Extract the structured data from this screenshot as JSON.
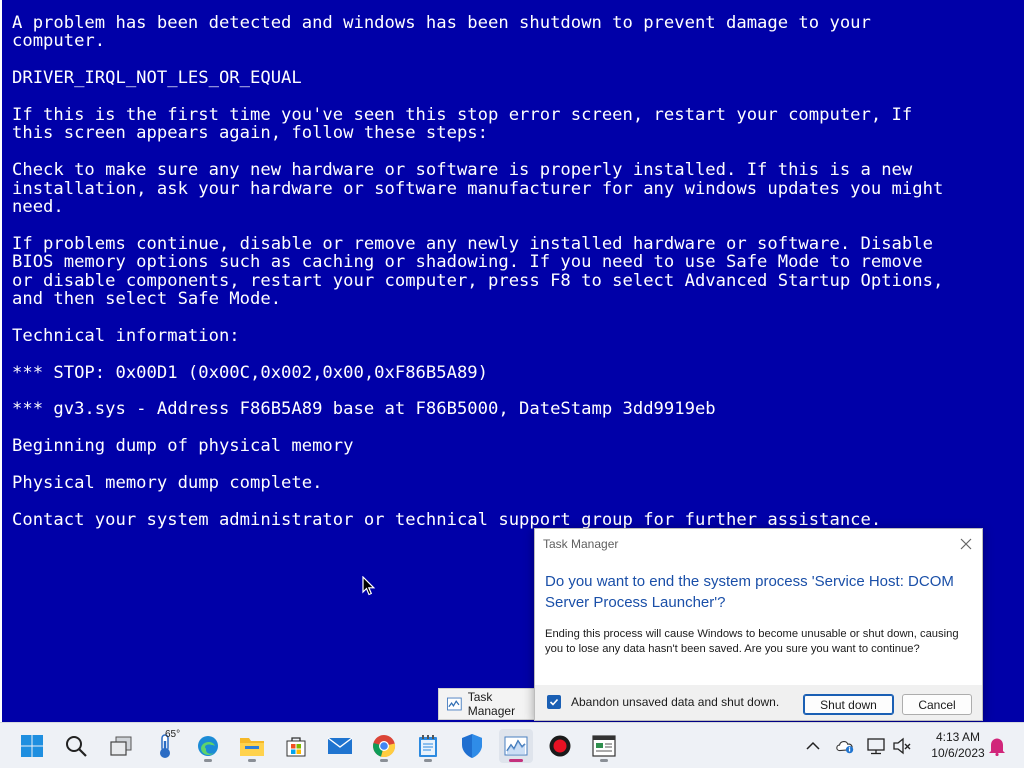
{
  "bsod": {
    "lines": [
      "A problem has been detected and windows has been shutdown to prevent damage to your",
      "computer.",
      "",
      "DRIVER_IRQL_NOT_LES_OR_EQUAL",
      "",
      "If this is the first time you've seen this stop error screen, restart your computer, If",
      "this screen appears again, follow these steps:",
      "",
      "Check to make sure any new hardware or software is properly installed. If this is a new",
      "installation, ask your hardware or software manufacturer for any windows updates you might",
      "need.",
      "",
      "If problems continue, disable or remove any newly installed hardware or software. Disable",
      "BIOS memory options such as caching or shadowing. If you need to use Safe Mode to remove",
      "or disable components, restart your computer, press F8 to select Advanced Startup Options,",
      "and then select Safe Mode.",
      "",
      "Technical information:",
      "",
      "*** STOP: 0x00D1 (0x00C,0x002,0x00,0xF86B5A89)",
      "",
      "*** gv3.sys - Address F86B5A89 base at F86B5000, DateStamp 3dd9919eb",
      "",
      "Beginning dump of physical memory",
      "",
      "Physical memory dump complete.",
      "",
      "Contact your system administrator or technical support group for further assistance."
    ]
  },
  "dialog": {
    "title": "Task Manager",
    "question": "Do you want to end the system process 'Service Host: DCOM Server Process Launcher'?",
    "message": "Ending this process will cause Windows to become unusable or shut down, causing you to lose any data hasn't been saved. Are you sure you want to continue?",
    "checkbox_label": "Abandon unsaved data and shut down.",
    "checkbox_checked": true,
    "shutdown_label": "Shut down",
    "cancel_label": "Cancel"
  },
  "taskbar": {
    "preview_label": "Task Manager",
    "weather_temp": "65°",
    "clock_time": "4:13 AM",
    "clock_date": "10/6/2023",
    "apps": [
      "start-icon",
      "search-icon",
      "task-view-icon",
      "weather-icon",
      "edge-icon",
      "file-explorer-icon",
      "store-icon",
      "mail-icon",
      "chrome-icon",
      "notepad-icon",
      "defender-icon",
      "task-manager-icon",
      "recorder-icon",
      "spreadsheet-icon"
    ]
  },
  "colors": {
    "bsod_bg": "#0000a8",
    "accent": "#1a5fb4",
    "question": "#1a4fa8"
  }
}
